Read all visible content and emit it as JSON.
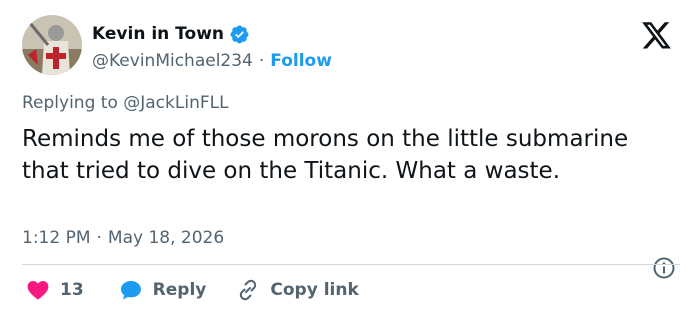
{
  "author": {
    "name": "Kevin in Town",
    "handle": "@KevinMichael234",
    "separator": "·",
    "follow_label": "Follow"
  },
  "replying": {
    "prefix": "Replying to ",
    "mention": "@JackLinFLL"
  },
  "tweet": {
    "text": "Reminds me of those morons on the little submarine that tried to dive on the Titanic. What a waste."
  },
  "meta": {
    "time": "1:12 PM",
    "separator": "·",
    "date": "May 18, 2026"
  },
  "actions": {
    "like_count": "13",
    "reply_label": "Reply",
    "copy_label": "Copy link"
  },
  "icons": {
    "verified": "verified-badge-icon",
    "x_logo": "x-logo-icon",
    "info": "info-icon",
    "like": "heart-icon",
    "reply": "speech-bubble-icon",
    "copy": "link-icon"
  },
  "colors": {
    "link": "#1d9bf0",
    "secondary_text": "#536471",
    "like": "#f91880",
    "reply": "#1d9bf0"
  }
}
